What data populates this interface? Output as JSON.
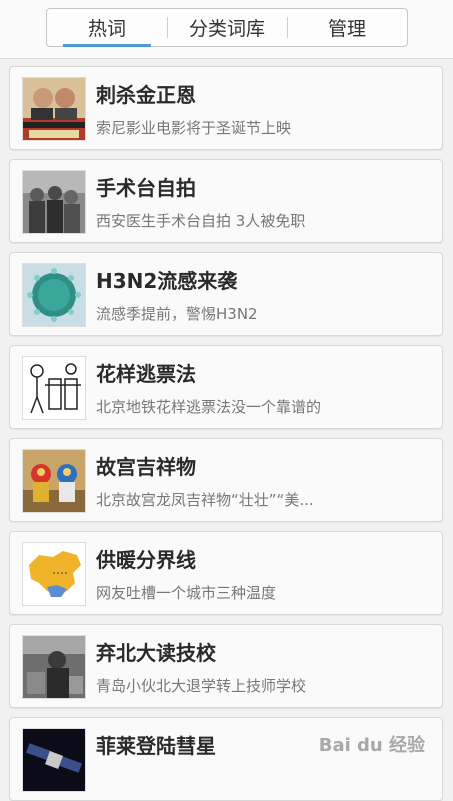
{
  "tabs": [
    {
      "label": "热词",
      "active": true
    },
    {
      "label": "分类词库",
      "active": false
    },
    {
      "label": "管理",
      "active": false
    }
  ],
  "items": [
    {
      "title": "刺杀金正恩",
      "subtitle": "索尼影业电影将于圣诞节上映",
      "image": "movie-poster-image"
    },
    {
      "title": "手术台自拍",
      "subtitle": "西安医生手术台自拍 3人被免职",
      "image": "surgery-photo-image"
    },
    {
      "title": "H3N2流感来袭",
      "subtitle": "流感季提前，警惕H3N2",
      "image": "virus-image"
    },
    {
      "title": "花样逃票法",
      "subtitle": "北京地铁花样逃票法没一个靠谱的",
      "image": "cartoon-image"
    },
    {
      "title": "故宫吉祥物",
      "subtitle": "北京故宫龙凤吉祥物“壮壮”“美...",
      "image": "mascot-image"
    },
    {
      "title": "供暖分界线",
      "subtitle": "网友吐槽一个城市三种温度",
      "image": "china-map-image"
    },
    {
      "title": "弃北大读技校",
      "subtitle": "青岛小伙北大退学转上技师学校",
      "image": "workshop-photo-image"
    },
    {
      "title": "菲莱登陆彗星",
      "subtitle": "",
      "image": "space-probe-image"
    }
  ],
  "watermark": "Bai du 经验",
  "colors": {
    "accent": "#4b9ad9",
    "title": "#2a2a2a",
    "subtitle": "#777777"
  }
}
